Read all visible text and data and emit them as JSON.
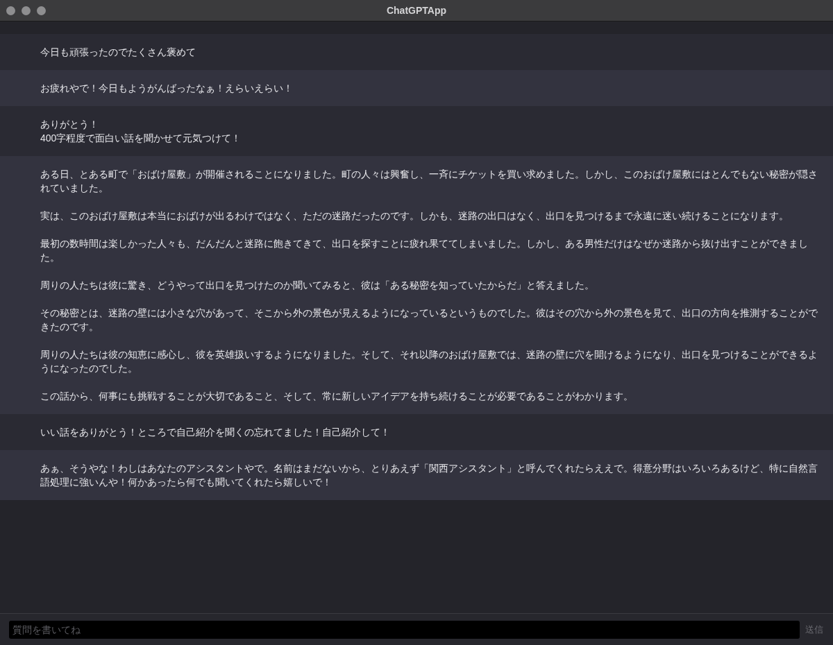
{
  "window": {
    "title": "ChatGPTApp"
  },
  "messages": [
    {
      "kind": "user",
      "paragraphs": [
        "今日も頑張ったのでたくさん褒めて"
      ]
    },
    {
      "kind": "assistant",
      "paragraphs": [
        "お疲れやで！今日もようがんばったなぁ！えらいえらい！"
      ]
    },
    {
      "kind": "user",
      "paragraphs": [
        "ありがとう！\n400字程度で面白い話を聞かせて元気つけて！"
      ]
    },
    {
      "kind": "assistant",
      "paragraphs": [
        "ある日、とある町で「おばけ屋敷」が開催されることになりました。町の人々は興奮し、一斉にチケットを買い求めました。しかし、このおばけ屋敷にはとんでもない秘密が隠されていました。",
        "実は、このおばけ屋敷は本当におばけが出るわけではなく、ただの迷路だったのです。しかも、迷路の出口はなく、出口を見つけるまで永遠に迷い続けることになります。",
        "最初の数時間は楽しかった人々も、だんだんと迷路に飽きてきて、出口を探すことに疲れ果ててしまいました。しかし、ある男性だけはなぜか迷路から抜け出すことができました。",
        "周りの人たちは彼に驚き、どうやって出口を見つけたのか聞いてみると、彼は「ある秘密を知っていたからだ」と答えました。",
        "その秘密とは、迷路の壁には小さな穴があって、そこから外の景色が見えるようになっているというものでした。彼はその穴から外の景色を見て、出口の方向を推測することができたのです。",
        "周りの人たちは彼の知恵に感心し、彼を英雄扱いするようになりました。そして、それ以降のおばけ屋敷では、迷路の壁に穴を開けるようになり、出口を見つけることができるようになったのでした。",
        "この話から、何事にも挑戦することが大切であること、そして、常に新しいアイデアを持ち続けることが必要であることがわかります。"
      ]
    },
    {
      "kind": "user",
      "paragraphs": [
        "いい話をありがとう！ところで自己紹介を聞くの忘れてました！自己紹介して！"
      ]
    },
    {
      "kind": "assistant",
      "paragraphs": [
        "あぁ、そうやな！わしはあなたのアシスタントやで。名前はまだないから、とりあえず「関西アシスタント」と呼んでくれたらええで。得意分野はいろいろあるけど、特に自然言語処理に強いんや！何かあったら何でも聞いてくれたら嬉しいで！"
      ]
    }
  ],
  "input": {
    "placeholder": "質問を書いてね"
  },
  "send_button": {
    "label": "送信"
  }
}
